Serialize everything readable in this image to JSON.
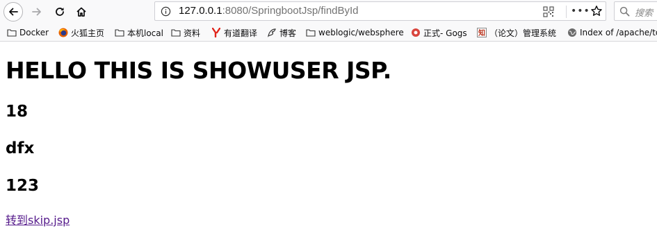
{
  "browser": {
    "url_host": "127.0.0.1",
    "url_rest": ":8080/SpringbootJsp/findById",
    "more_label": "•••",
    "search_placeholder": "搜索"
  },
  "bookmarks": [
    {
      "label": "Docker",
      "icon": "folder-icon"
    },
    {
      "label": "火狐主页",
      "icon": "firefox-icon"
    },
    {
      "label": "本机local",
      "icon": "folder-icon"
    },
    {
      "label": "资料",
      "icon": "folder-icon"
    },
    {
      "label": "有道翻译",
      "icon": "youdao-icon"
    },
    {
      "label": "博客",
      "icon": "blog-icon"
    },
    {
      "label": "weblogic/websphere",
      "icon": "folder-icon"
    },
    {
      "label": "正式- Gogs",
      "icon": "gogs-icon"
    },
    {
      "label": "（论文）管理系统",
      "icon": "zhi-icon"
    },
    {
      "label": "Index of /apache/to",
      "icon": "globe-icon"
    }
  ],
  "page": {
    "heading": "HELLO THIS IS SHOWUSER JSP.",
    "values": [
      "18",
      "dfx",
      "123"
    ],
    "link_text": "转到skip.jsp"
  }
}
